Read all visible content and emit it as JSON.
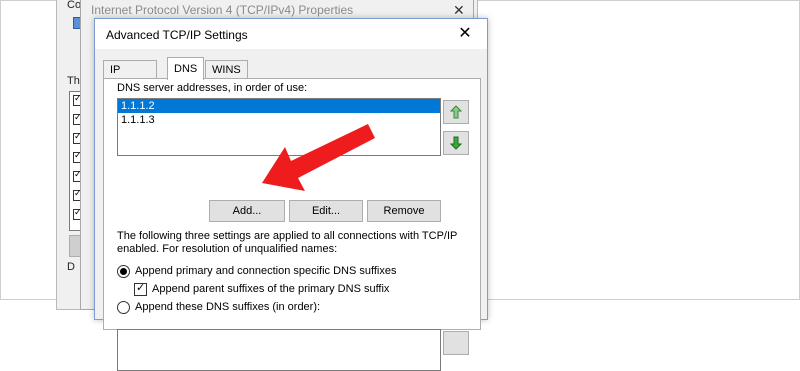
{
  "background_windows": {
    "network_properties": {
      "connect_using_label": "Connect using:",
      "items_label": "Th",
      "desc_label": "D"
    },
    "ipv4_properties": {
      "title": "Internet Protocol Version 4 (TCP/IPv4) Properties",
      "close_glyph": "✕"
    }
  },
  "dialog": {
    "title": "Advanced TCP/IP Settings",
    "close_glyph": "✕",
    "tabs": [
      {
        "label": "IP Settings",
        "active": false
      },
      {
        "label": "DNS",
        "active": true
      },
      {
        "label": "WINS",
        "active": false
      }
    ],
    "dns": {
      "servers_label": "DNS server addresses, in order of use:",
      "servers": [
        {
          "address": "1.1.1.2",
          "selected": true
        },
        {
          "address": "1.1.1.3",
          "selected": false
        }
      ],
      "move_up_icon": "green-up-arrow-icon",
      "move_down_icon": "green-down-arrow-icon",
      "buttons": {
        "add": "Add...",
        "edit": "Edit...",
        "remove": "Remove"
      },
      "info_text": "The following three settings are applied to all connections with TCP/IP enabled. For resolution of unqualified names:",
      "options": {
        "append_primary": {
          "label": "Append primary and connection specific DNS suffixes",
          "checked": true
        },
        "append_parent": {
          "label": "Append parent suffixes of the primary DNS suffix",
          "checked": true
        },
        "append_these": {
          "label": "Append these DNS suffixes (in order):",
          "checked": false
        }
      }
    }
  },
  "annotation": {
    "color": "#ee1c1c",
    "points_to": "add-button"
  }
}
